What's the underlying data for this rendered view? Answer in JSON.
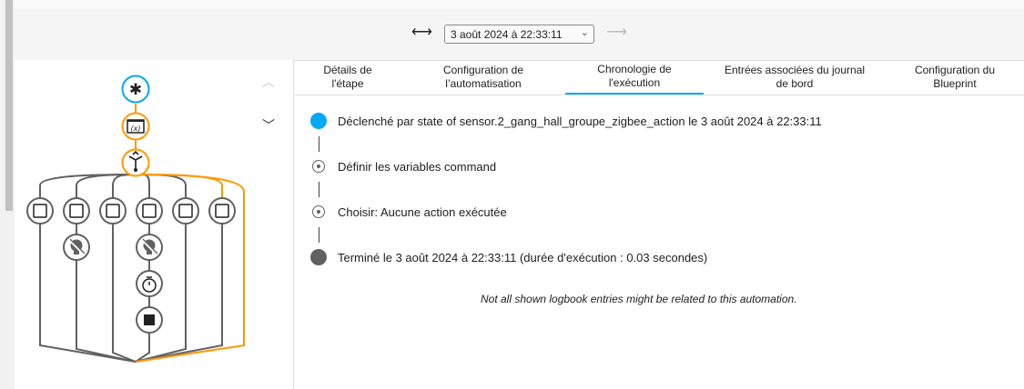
{
  "run_selector": {
    "selected": "3 août 2024 à 22:33:11"
  },
  "tabs": [
    {
      "label": "Détails de\nl'étape",
      "active": false
    },
    {
      "label": "Configuration de\nl’automatisation",
      "active": false
    },
    {
      "label": "Chronologie de\nl'exécution",
      "active": true
    },
    {
      "label": "Entrées associées du journal\nde bord",
      "active": false
    },
    {
      "label": "Configuration du\nBlueprint",
      "active": false
    }
  ],
  "timeline": {
    "trigger": "Déclenché par state of sensor.2_gang_hall_groupe_zigbee_action le 3 août 2024 à 22:33:11",
    "step1": "Définir les variables command",
    "step2": "Choisir: Aucune action exécutée",
    "end": "Terminé le 3 août 2024 à 22:33:11 (durée d'exécution : 0.03 secondes)"
  },
  "notice": "Not all shown logbook entries might be related to this automation.",
  "colors": {
    "accent": "#03a9f4",
    "active_path": "#ff9800",
    "node_inactive": "#616161"
  },
  "icons": {
    "prev": "arrow-left-right-icon",
    "next": "arrow-right-disabled-icon",
    "nav_up": "chevron-up-icon",
    "nav_down": "chevron-down-icon"
  }
}
